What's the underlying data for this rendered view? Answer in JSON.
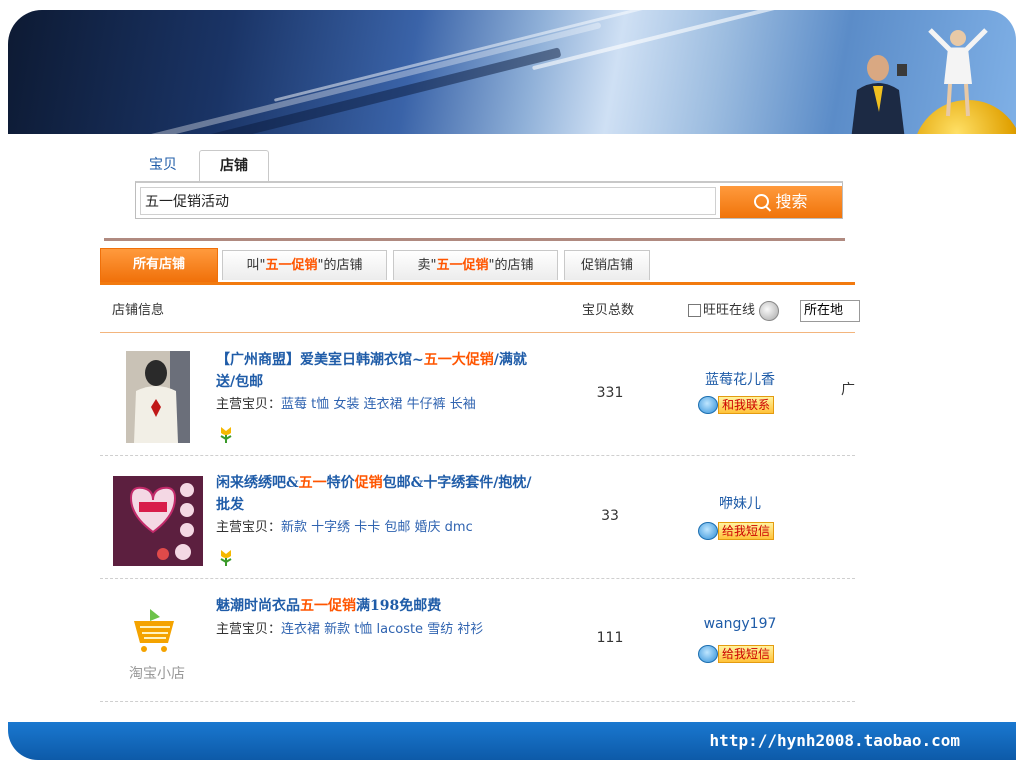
{
  "search": {
    "tab_baobei": "宝贝",
    "tab_dianpu": "店铺",
    "query": "五一促销活动",
    "button_label": "搜索"
  },
  "shop_tabs": {
    "all": "所有店铺",
    "named_prefix": "叫\"",
    "named_keyword": "五一促销",
    "named_suffix": "\"的店铺",
    "sell_prefix": "卖\"",
    "sell_keyword": "五一促销",
    "sell_suffix": "\"的店铺",
    "promo": "促销店铺"
  },
  "columns": {
    "shop_info": "店铺信息",
    "total_items": "宝贝总数",
    "online_label": "旺旺在线",
    "location": "所在地"
  },
  "rows": [
    {
      "title_a": "【广州商盟】爱美室日韩潮衣馆~",
      "title_hl": "五一大促销",
      "title_b": "/满就送/包邮",
      "main_label": "主营宝贝：",
      "tags": "蓝莓 t恤 女装 连衣裙 牛仔裤 长袖",
      "count": "331",
      "seller": "蓝莓花儿香",
      "contact": "和我联系",
      "region": "广"
    },
    {
      "title_a": "闲来绣绣吧&",
      "title_hl1": "五一",
      "title_mid": "特价",
      "title_hl2": "促销",
      "title_b": "包邮&十字绣套件/抱枕/批发",
      "main_label": "主营宝贝：",
      "tags": "新款 十字绣 卡卡 包邮 婚庆 dmc",
      "count": "33",
      "seller": "咿妹儿",
      "contact": "给我短信"
    },
    {
      "title_a": "魅潮时尚衣品",
      "title_hl": "五一促销",
      "title_b": "满198免邮费",
      "main_label": "主营宝贝：",
      "tags": "连衣裙 新款 t恤 lacoste 雪纺 衬衫",
      "count": "111",
      "seller": "wangy197",
      "contact": "给我短信",
      "thumb_caption": "淘宝小店"
    }
  ],
  "footer": {
    "url": "http://hynh2008.taobao.com"
  },
  "colors": {
    "accent_orange": "#f27a0f",
    "link_blue": "#1f5ca8",
    "highlight": "#ff5500",
    "footer_blue": "#1a78d0"
  }
}
